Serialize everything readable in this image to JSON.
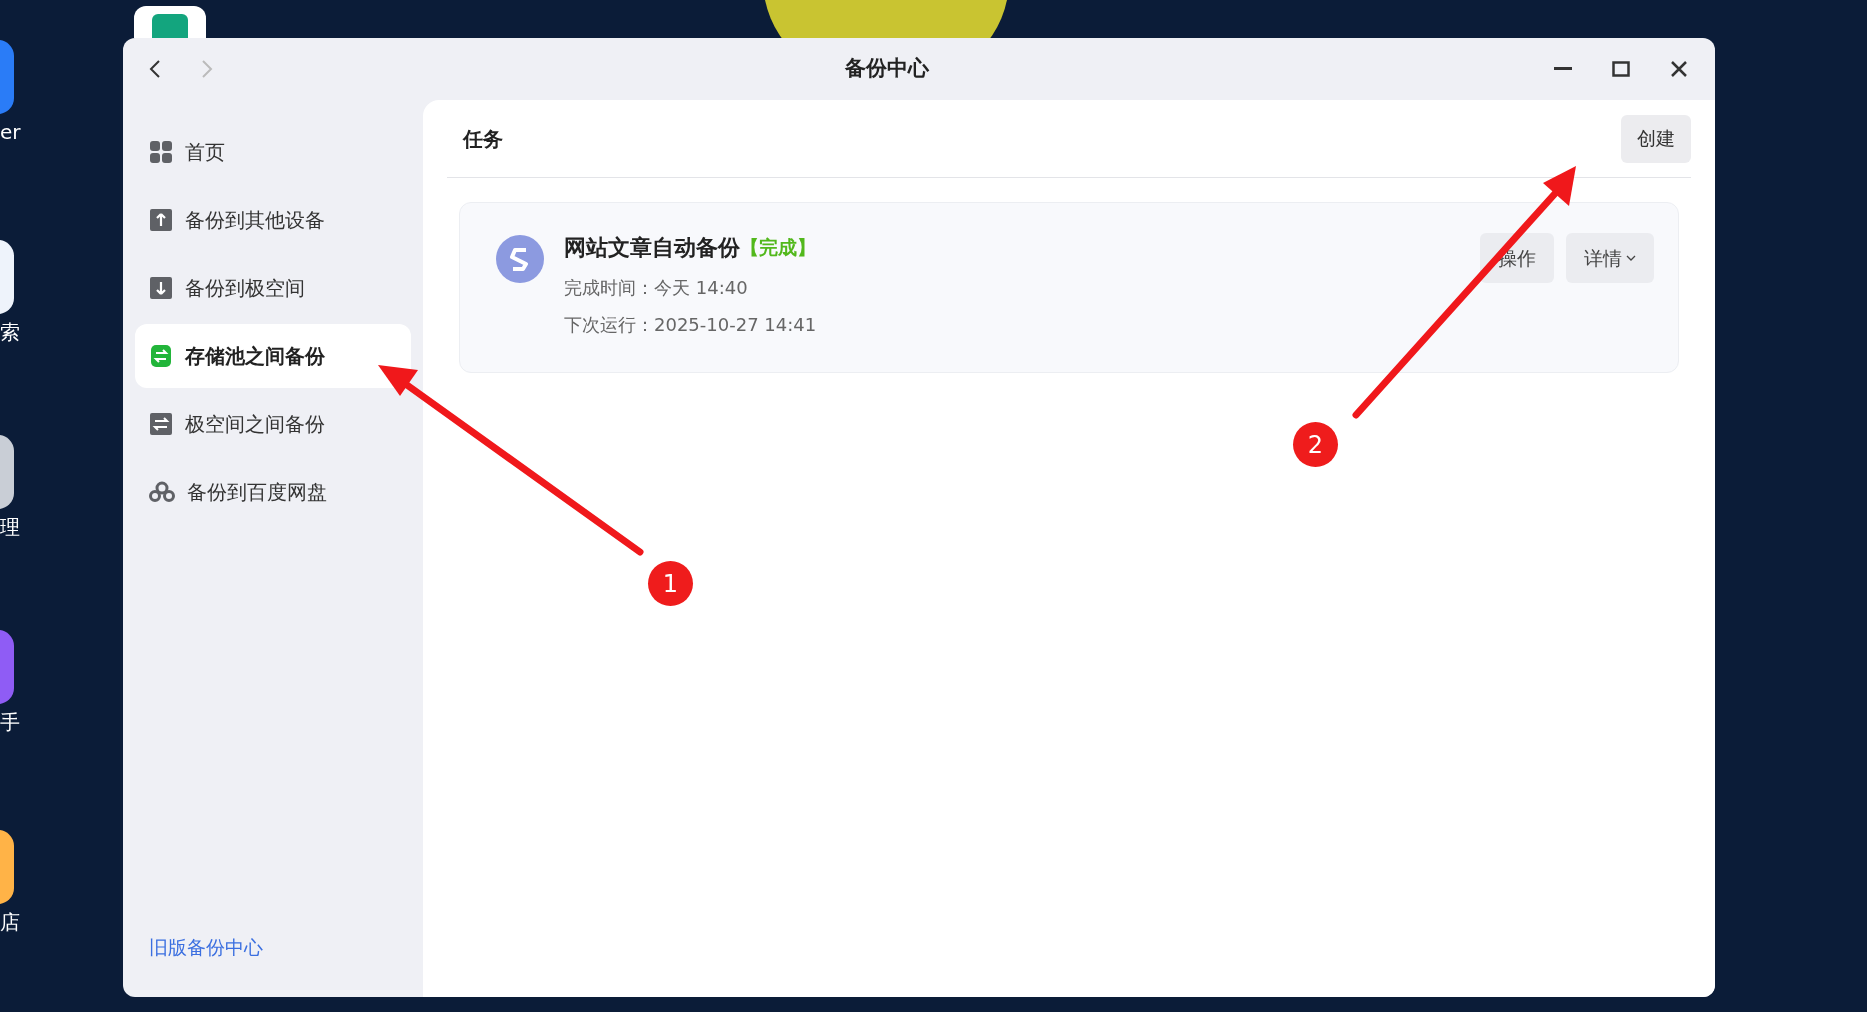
{
  "desktop": {
    "icon_labels": [
      "er",
      "索",
      "理",
      "手",
      "店"
    ]
  },
  "window": {
    "title": "备份中心",
    "nav": {
      "back_enabled": true,
      "forward_enabled": false
    }
  },
  "sidebar": {
    "items": [
      {
        "label": "首页",
        "kind": "grid",
        "selected": false
      },
      {
        "label": "备份到其他设备",
        "kind": "upload",
        "selected": false
      },
      {
        "label": "备份到极空间",
        "kind": "download",
        "selected": false
      },
      {
        "label": "存储池之间备份",
        "kind": "pool",
        "selected": true
      },
      {
        "label": "极空间之间备份",
        "kind": "swap",
        "selected": false
      },
      {
        "label": "备份到百度网盘",
        "kind": "cloud",
        "selected": false
      }
    ],
    "footer_link": "旧版备份中心"
  },
  "content": {
    "header": "任务",
    "create_button": "创建",
    "tasks": [
      {
        "name": "网站文章自动备份",
        "status": "【完成】",
        "lines": [
          "完成时间：今天 14:40",
          "下次运行：2025-10-27 14:41"
        ],
        "buttons": [
          {
            "label": "操作",
            "kind": "plain"
          },
          {
            "label": "详情",
            "kind": "dropdown"
          }
        ]
      }
    ]
  },
  "annotations": [
    {
      "label": "1"
    },
    {
      "label": "2"
    }
  ]
}
